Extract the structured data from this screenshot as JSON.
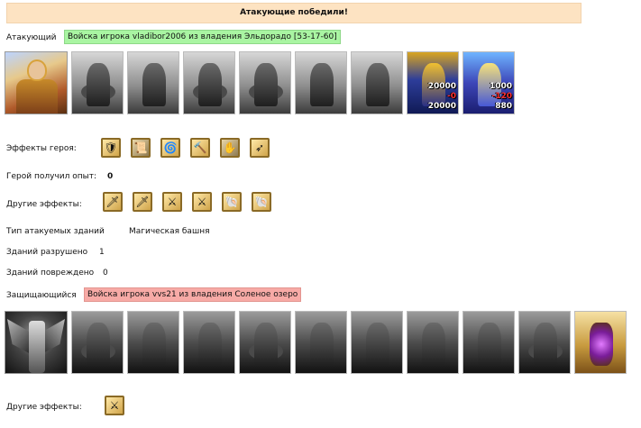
{
  "result_banner": "Атакующие победили!",
  "attacker": {
    "label": "Атакующий",
    "army": "Войска игрока vladibor2006 из владения Эльдорадо [53-17-60]",
    "units": [
      {
        "counts": []
      },
      {
        "counts": []
      },
      {
        "counts": []
      },
      {
        "counts": []
      },
      {
        "counts": []
      },
      {
        "counts": []
      },
      {
        "counts": []
      },
      {
        "counts": [
          "20000",
          "-0",
          "20000"
        ]
      },
      {
        "counts": [
          "1000",
          "-120",
          "880"
        ]
      }
    ],
    "hero_effects_label": "Эффекты героя:",
    "hero_effects": [
      "shield-icon",
      "dark-scroll-icon",
      "swirl-icon",
      "hammer-icon",
      "claw-icon",
      "spear-icon"
    ],
    "experience_label": "Герой получил опыт:",
    "experience_value": "0",
    "other_effects_label": "Другие эффекты:",
    "other_effects": [
      "sword-icon",
      "sword-icon",
      "sword-wing-icon",
      "sword-wing-icon",
      "scroll-gold-icon",
      "scroll-gold-icon"
    ]
  },
  "buildings": {
    "type_label": "Тип атакуемых зданий",
    "type_value": "Магическая башня",
    "destroyed_label": "Зданий разрушено",
    "destroyed_value": "1",
    "damaged_label": "Зданий повреждено",
    "damaged_value": "0"
  },
  "defender": {
    "label": "Защищающийся",
    "army": "Войска игрока vvs21 из владения Соленое озеро",
    "other_effects_label": "Другие эффекты:",
    "other_effects": [
      "sword-wing-icon"
    ]
  }
}
